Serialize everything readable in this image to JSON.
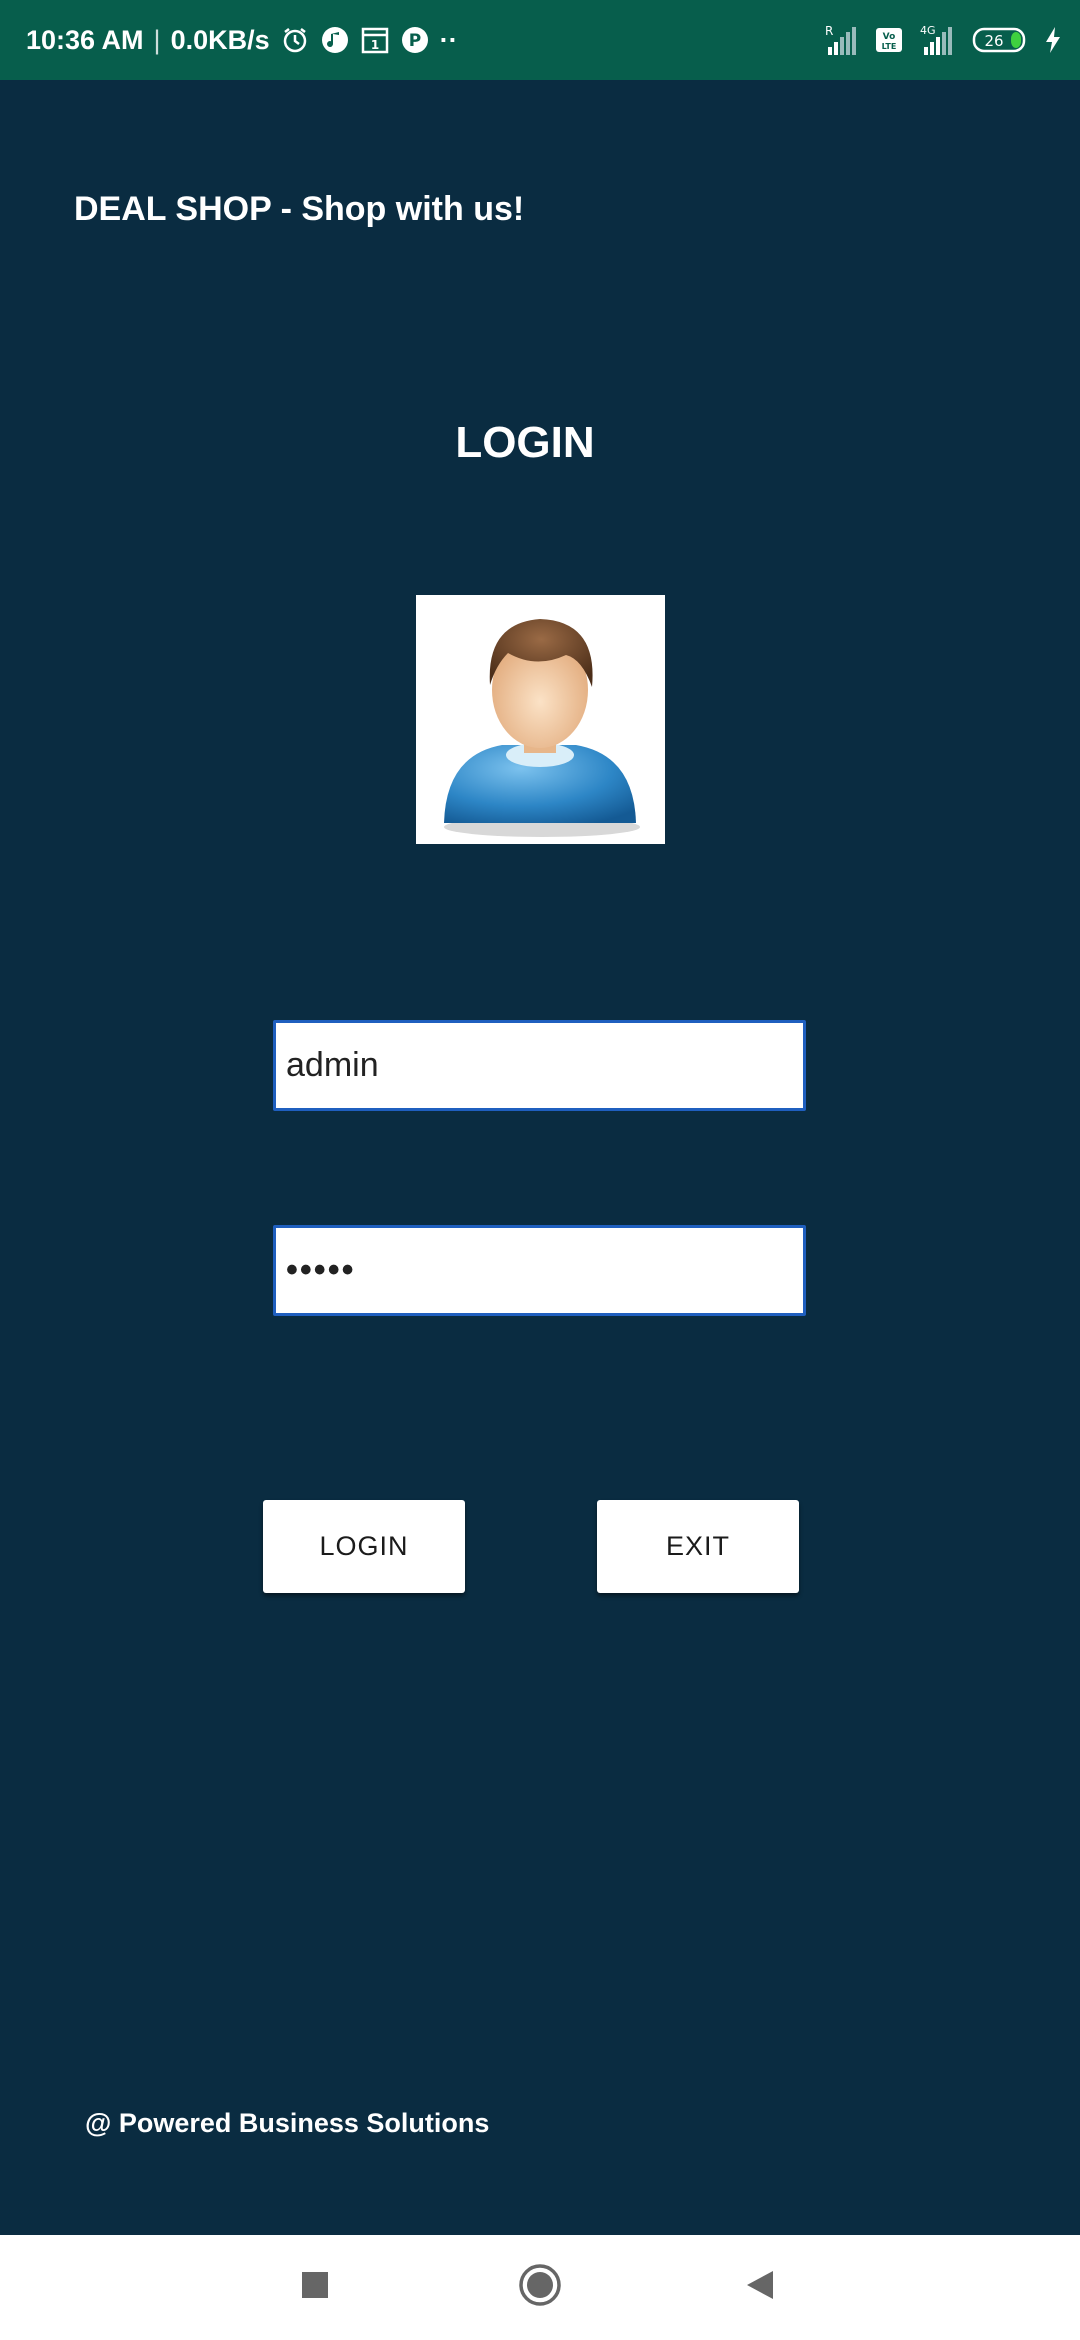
{
  "status_bar": {
    "time": "10:36 AM",
    "separator": "|",
    "net_speed": "0.0KB/s",
    "more": "··",
    "battery": "26",
    "sim_label_r": "R",
    "volte_label": "Vo LTE",
    "network_label": "4G"
  },
  "app": {
    "header": "DEAL SHOP - Shop with us!",
    "login_title": "LOGIN"
  },
  "form": {
    "username_value": "admin",
    "password_value": "•••••"
  },
  "buttons": {
    "login_label": "LOGIN",
    "exit_label": "EXIT"
  },
  "footer": {
    "text": "@ Powered Business Solutions"
  },
  "colors": {
    "status_bar_bg": "#075e4c",
    "app_bg": "#0a2c41",
    "field_border": "#1f5fbf",
    "battery_green": "#3fd13f"
  },
  "icons": {
    "status": [
      "alarm-icon",
      "music-icon",
      "calendar-icon",
      "paytm-icon",
      "signal-icon",
      "volte-icon",
      "battery-icon",
      "charging-icon"
    ],
    "nav": [
      "recents-icon",
      "home-icon",
      "back-icon"
    ],
    "avatar": "user-avatar-icon"
  }
}
